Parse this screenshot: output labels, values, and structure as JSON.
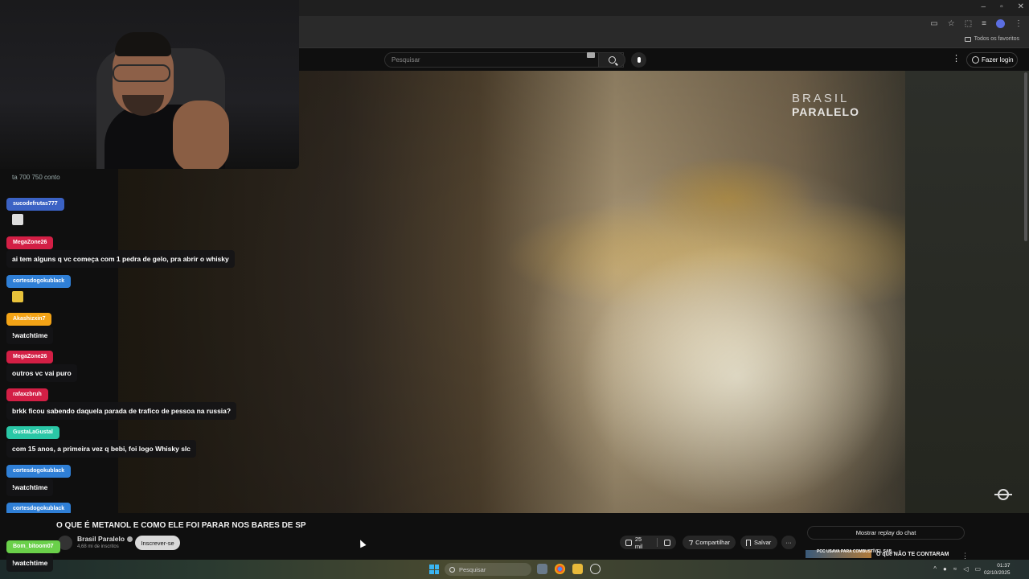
{
  "browser": {
    "bookmarks_label": "Todos os favoritos"
  },
  "header": {
    "search_placeholder": "Pesquisar",
    "login_label": "Fazer login"
  },
  "video": {
    "watermark_line1": "BRASIL",
    "watermark_line2": "PARALELO",
    "title": "O QUE É METANOL E COMO ELE FOI PARAR NOS BARES DE SP",
    "channel_name": "Brasil Paralelo",
    "subscribers": "4,68 mi de inscritos",
    "subscribe_label": "Inscrever-se",
    "likes": "25 mil",
    "share_label": "Compartilhar",
    "save_label": "Salvar"
  },
  "sidebar": {
    "chat_replay_label": "Mostrar replay do chat",
    "rec_thumb_text": "PCC USAVA PARA COMBUSTÍVEL SAB...",
    "rec_title": "O que NÃO TE CONTARAM"
  },
  "chat": {
    "top_fragment": "ta 700 750 conto",
    "messages": [
      {
        "user": "sucodefrutas777",
        "text": "",
        "color": "#3b62c4"
      },
      {
        "user": "MegaZone26",
        "text": "ai tem alguns q vc começa com 1 pedra de gelo, pra abrir o whisky",
        "color": "#d31f45"
      },
      {
        "user": "cortesdogokublack",
        "text": "",
        "color": "#2f7fd6"
      },
      {
        "user": "Akashizxin7",
        "text": "!watchtime",
        "color": "#f3a316"
      },
      {
        "user": "MegaZone26",
        "text": "outros vc vai puro",
        "color": "#d31f45"
      },
      {
        "user": "rafaxzbruh",
        "text": "brkk ficou sabendo daquela parada de trafico de pessoa na russia?",
        "color": "#d31f45"
      },
      {
        "user": "GustaLaGustal",
        "text": "com 15 anos, a primeira vez q bebi, foi logo Whisky slc",
        "color": "#2ac7a6"
      },
      {
        "user": "cortesdogokublack",
        "text": "!watchtime",
        "color": "#2f7fd6"
      },
      {
        "user": "cortesdogokublack",
        "text": "",
        "color": "#2f7fd6"
      },
      {
        "user": "Bom_bitoom07",
        "text": "!watchtime",
        "color": "#6ad04a"
      }
    ]
  },
  "taskbar": {
    "search_placeholder": "Pesquisar",
    "time": "01:37",
    "date": "02/10/2025"
  }
}
